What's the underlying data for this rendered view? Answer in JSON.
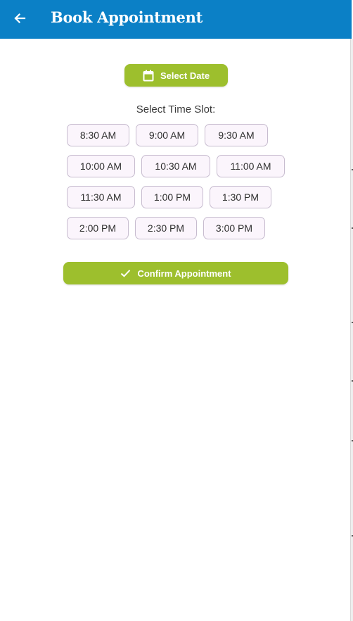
{
  "appbar": {
    "title": "Book Appointment",
    "back_icon": "arrow-left-icon",
    "color": "#0b80c6"
  },
  "select_date": {
    "label": "Select Date",
    "icon": "calendar-icon"
  },
  "time_slot_heading": "Select Time Slot:",
  "time_slots": [
    [
      "8:30 AM",
      "9:00 AM",
      "9:30 AM"
    ],
    [
      "10:00 AM",
      "10:30 AM",
      "11:00 AM"
    ],
    [
      "11:30 AM",
      "1:00 PM",
      "1:30 PM"
    ],
    [
      "2:00 PM",
      "2:30 PM",
      "3:00 PM"
    ]
  ],
  "confirm": {
    "label": "Confirm Appointment",
    "icon": "check-icon"
  },
  "colors": {
    "accent_green": "#9dbf2d",
    "slot_background": "#fbf5fc",
    "slot_border": "#c7bccf"
  }
}
